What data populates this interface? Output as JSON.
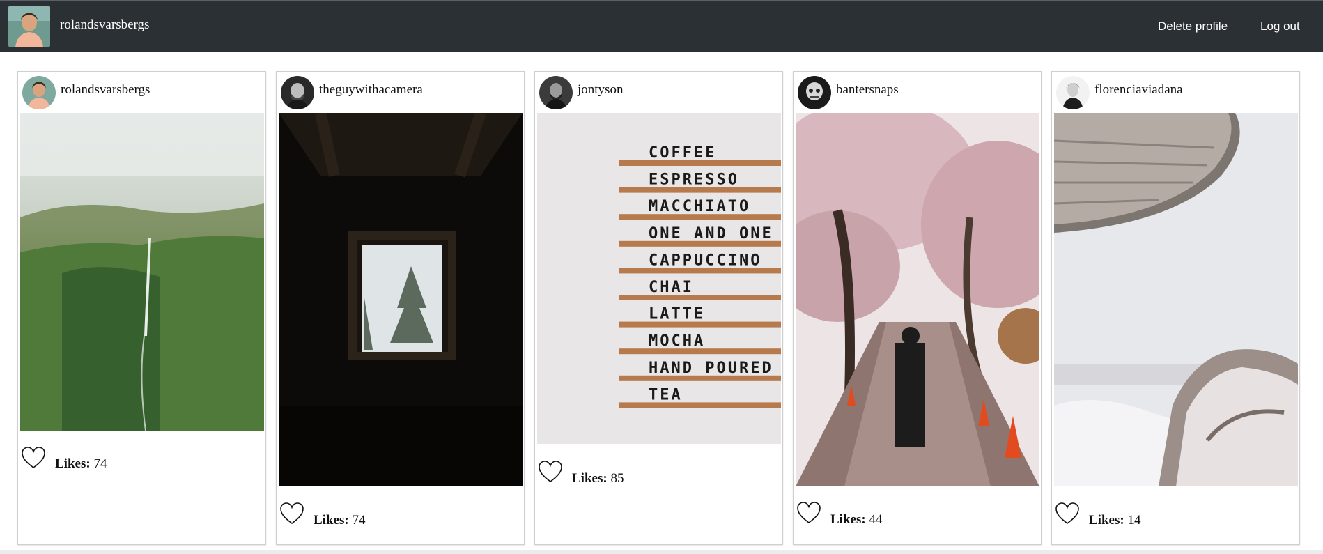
{
  "header": {
    "username": "rolandsvarsbergs",
    "delete_label": "Delete profile",
    "logout_label": "Log out"
  },
  "likes_label": "Likes:",
  "posts": [
    {
      "username": "rolandsvarsbergs",
      "likes": "74"
    },
    {
      "username": "theguywithacamera",
      "likes": "74"
    },
    {
      "username": "jontyson",
      "likes": "85"
    },
    {
      "username": "bantersnaps",
      "likes": "44"
    },
    {
      "username": "florenciaviadana",
      "likes": "14"
    }
  ],
  "menu_board": {
    "items": [
      "COFFEE",
      "ESPRESSO",
      "MACCHIATO",
      "ONE AND ONE",
      "CAPPUCCINO",
      "CHAI",
      "LATTE",
      "MOCHA",
      "HAND POURED",
      "TEA"
    ]
  },
  "colors": {
    "header_bg": "#2b3035",
    "card_border": "#cfcfcf"
  }
}
